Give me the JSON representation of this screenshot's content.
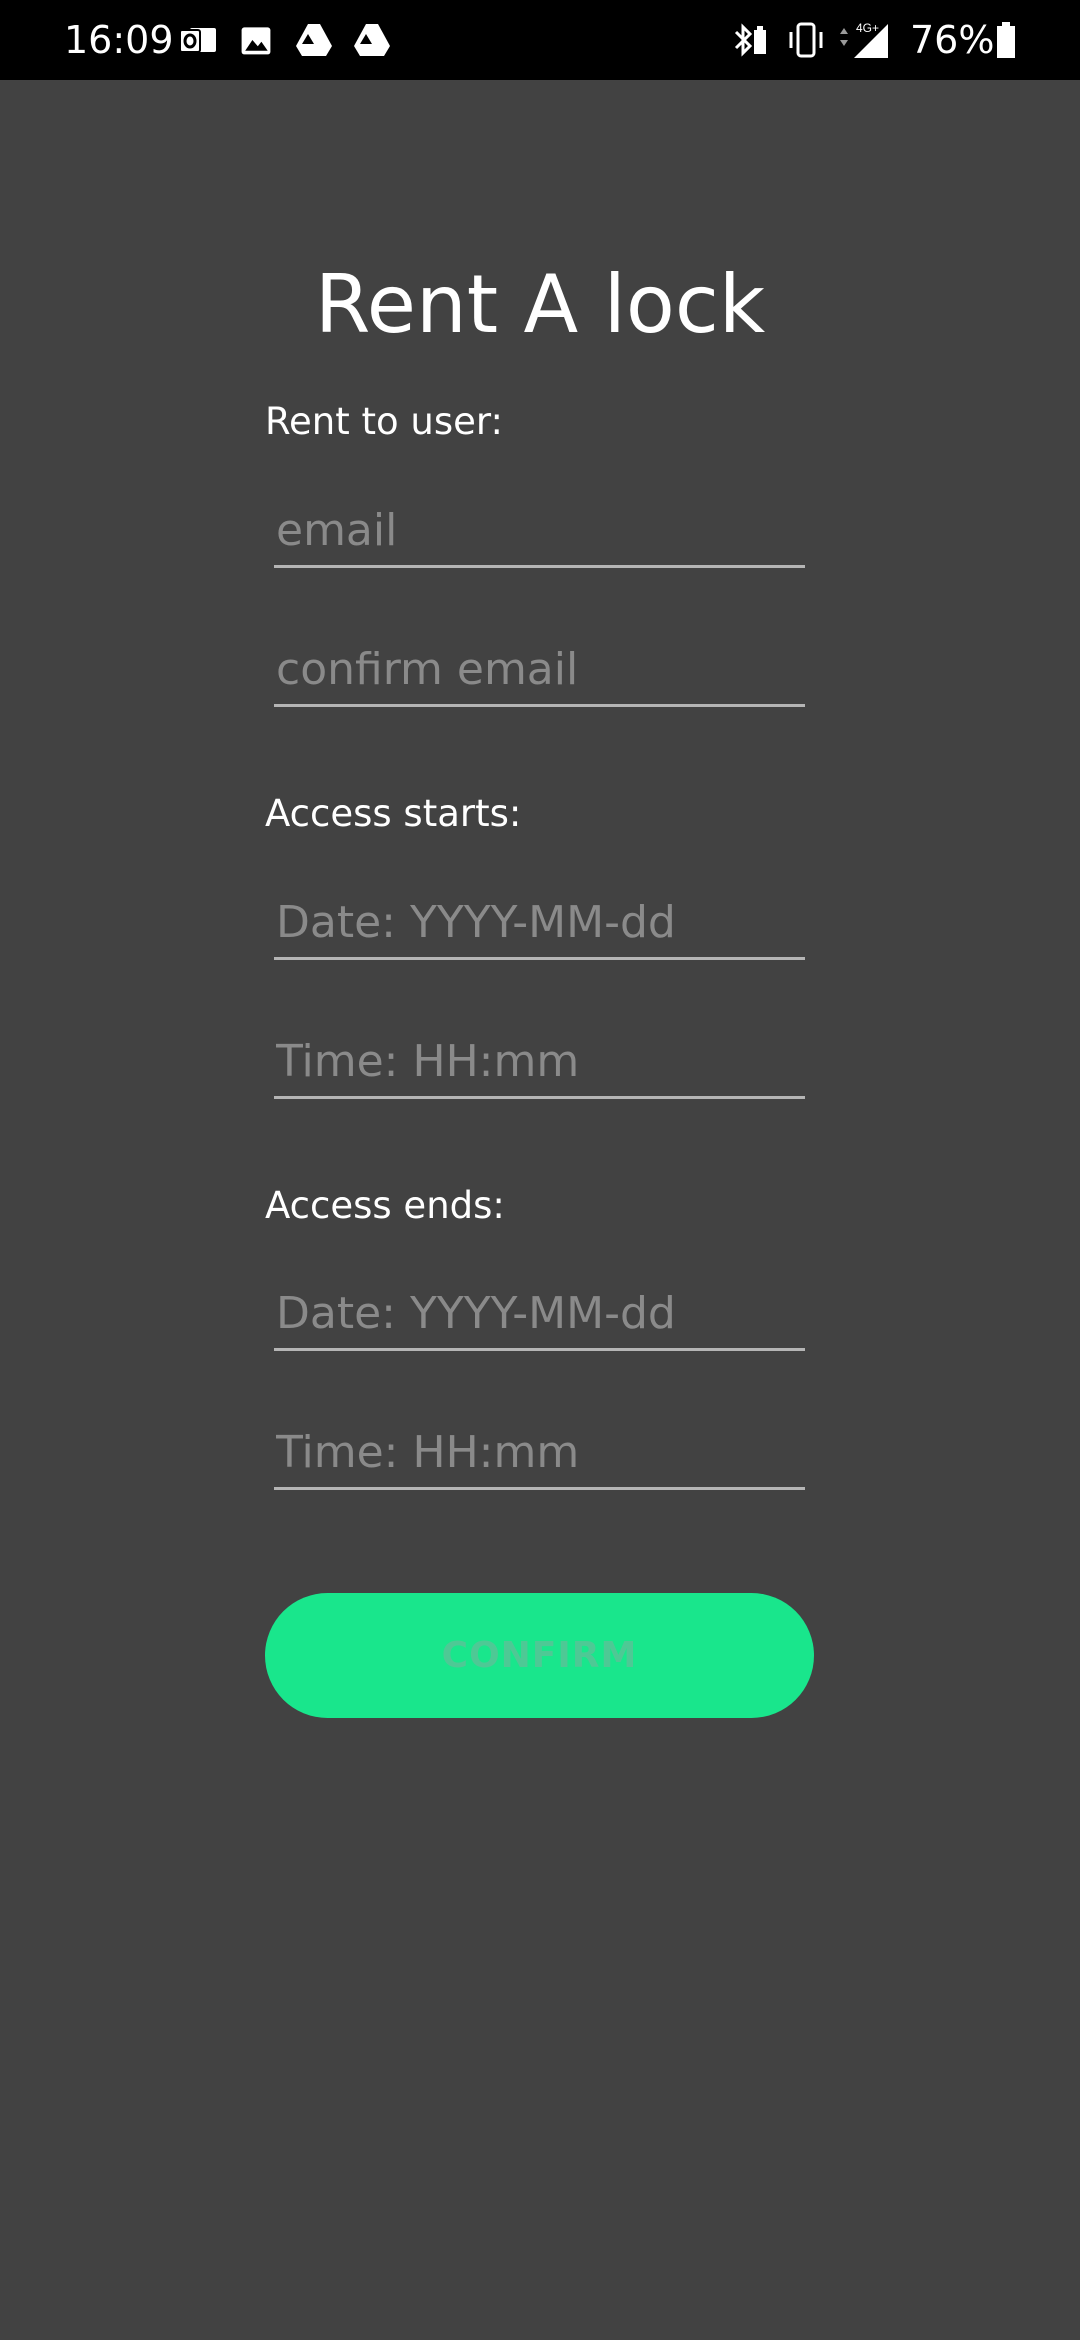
{
  "status_bar": {
    "time": "16:09",
    "battery_percent": "76%",
    "network_label": "4G+",
    "left_icons": [
      "outlook-icon",
      "gallery-icon",
      "drive-icon",
      "drive-icon"
    ],
    "right_icons": [
      "bluetooth-battery-icon",
      "vibrate-icon",
      "signal-icon",
      "battery-icon"
    ]
  },
  "page": {
    "title": "Rent A lock"
  },
  "sections": {
    "rent_to_user": {
      "label": "Rent to user:",
      "email_placeholder": "email",
      "confirm_email_placeholder": "confirm email"
    },
    "access_starts": {
      "label": "Access starts:",
      "date_placeholder": "Date: YYYY-MM-dd",
      "time_placeholder": "Time: HH:mm"
    },
    "access_ends": {
      "label": "Access ends:",
      "date_placeholder": "Date: YYYY-MM-dd",
      "time_placeholder": "Time: HH:mm"
    }
  },
  "confirm_button": {
    "label": "CONFIRM"
  },
  "colors": {
    "background": "#424242",
    "status_bar": "#000000",
    "accent": "#19e68c",
    "button_text": "#4ec995",
    "placeholder": "#8a8a8a",
    "underline": "#b5b5b5"
  }
}
